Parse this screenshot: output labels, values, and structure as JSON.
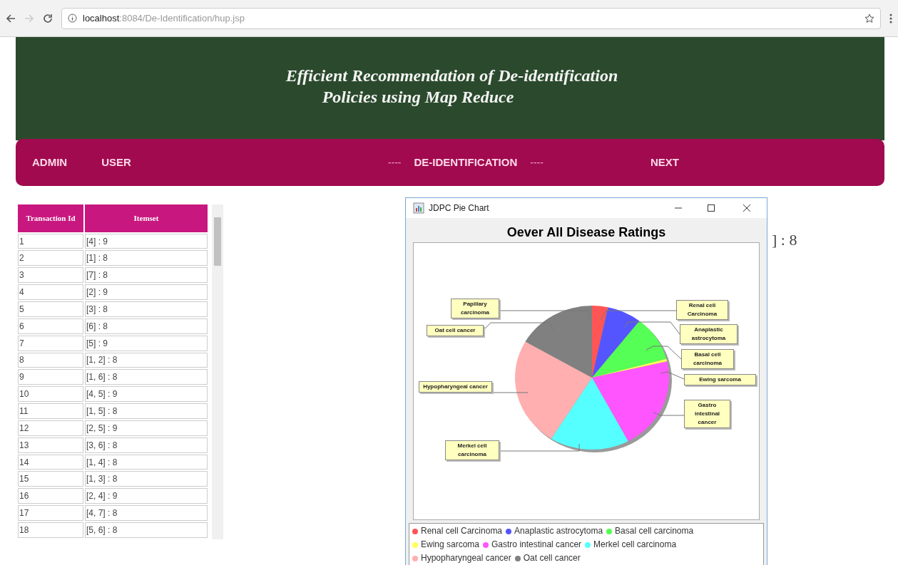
{
  "browser": {
    "url_host": "localhost",
    "url_path": ":8084/De-Identification/hup.jsp"
  },
  "header": {
    "title_line_1": "Efficient Recommendation of De-identification",
    "title_line_2": "Policies using Map Reduce"
  },
  "nav": [
    {
      "kind": "link",
      "label": "ADMIN"
    },
    {
      "kind": "link",
      "label": "USER"
    },
    {
      "kind": "separator",
      "label": "----"
    },
    {
      "kind": "link",
      "label": "DE-IDENTIFICATION"
    },
    {
      "kind": "separator",
      "label": "----"
    },
    {
      "kind": "link",
      "label": "NEXT"
    }
  ],
  "table": {
    "columns": [
      "Transaction Id",
      "Itemset"
    ],
    "rows": [
      [
        "1",
        "[4] : 9"
      ],
      [
        "2",
        "[1] : 8"
      ],
      [
        "3",
        "[7] : 8"
      ],
      [
        "4",
        "[2] : 9"
      ],
      [
        "5",
        "[3] : 8"
      ],
      [
        "6",
        "[6] : 8"
      ],
      [
        "7",
        "[5] : 9"
      ],
      [
        "8",
        "[1, 2] : 8"
      ],
      [
        "9",
        "[1, 6] : 8"
      ],
      [
        "10",
        "[4, 5] : 9"
      ],
      [
        "11",
        "[1, 5] : 8"
      ],
      [
        "12",
        "[2, 5] : 9"
      ],
      [
        "13",
        "[3, 6] : 8"
      ],
      [
        "14",
        "[1, 4] : 8"
      ],
      [
        "15",
        "[1, 3] : 8"
      ],
      [
        "16",
        "[2, 4] : 9"
      ],
      [
        "17",
        "[4, 7] : 8"
      ],
      [
        "18",
        "[5, 6] : 8"
      ]
    ]
  },
  "background_text": "] : 8",
  "dialog": {
    "title": "JDPC Pie Chart",
    "chart_title": "Oever All Disease Ratings",
    "callouts": [
      "Papillary carcinoma",
      "Oat cell cancer",
      "Renal cell Carcinoma",
      "Anaplastic astrocytoma",
      "Basal cell carcinoma",
      "Ewing sarcoma",
      "Gastro intestinal cancer",
      "Hypopharyngeal cancer",
      "Merkel cell carcinoma"
    ],
    "legend": [
      {
        "label": "Renal cell Carcinoma",
        "color": "#ff5555"
      },
      {
        "label": "Anaplastic astrocytoma",
        "color": "#5555ff"
      },
      {
        "label": "Basal cell carcinoma",
        "color": "#55ff55"
      },
      {
        "label": "Ewing sarcoma",
        "color": "#ffff55"
      },
      {
        "label": "Gastro intestinal cancer",
        "color": "#ff55ff"
      },
      {
        "label": "Merkel cell carcinoma",
        "color": "#55ffff"
      },
      {
        "label": "Hypopharyngeal cancer",
        "color": "#ffafaf"
      },
      {
        "label": "Oat cell cancer",
        "color": "#808080"
      }
    ]
  }
}
